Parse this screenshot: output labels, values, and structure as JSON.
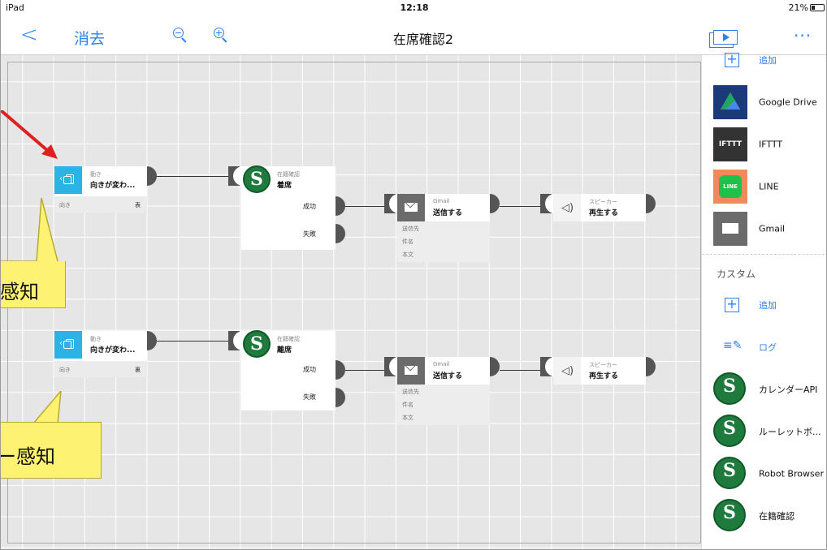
{
  "status_bar": {
    "device": "iPad",
    "time": "12:18",
    "right_info": "21%"
  },
  "nav": {
    "back_glyph": "<",
    "erase": "消去",
    "title": "在席確認2"
  },
  "flow": {
    "row1": {
      "motion": {
        "type": "動き",
        "name": "向きが変わ...",
        "param_key": "向き",
        "param_value": "表"
      },
      "presence": {
        "type": "在籍確認",
        "name": "着席",
        "out1": "成功",
        "out2": "失敗"
      },
      "gmail": {
        "type": "Gmail",
        "name": "送信する",
        "params": [
          "送信先",
          "件名",
          "本文"
        ]
      },
      "speaker": {
        "type": "スピーカー",
        "name": "再生する"
      }
    },
    "row2": {
      "motion": {
        "type": "動き",
        "name": "向きが変わ...",
        "param_key": "向き",
        "param_value": "裏"
      },
      "presence": {
        "type": "在籍確認",
        "name": "離席",
        "out1": "成功",
        "out2": "失敗"
      },
      "gmail": {
        "type": "Gmail",
        "name": "送信する",
        "params": [
          "送信先",
          "件名",
          "本文"
        ]
      },
      "speaker": {
        "type": "スピーカー",
        "name": "再生する"
      }
    }
  },
  "callouts": {
    "top": "感知",
    "bottom": "ー感知"
  },
  "sidebar": {
    "top_add": "追加",
    "items": [
      "Google Drive",
      "IFTTT",
      "LINE",
      "Gmail"
    ],
    "ifttt_logo": "IFTTT",
    "line_logo": "LINE",
    "custom_section": "カスタム",
    "custom_add": "追加",
    "log": "ログ",
    "custom_items": [
      "カレンダーAPI",
      "ルーレットボ...",
      "Robot Browser",
      "在籍確認"
    ]
  },
  "colors": {
    "accent": "#2f80ed",
    "motion": "#2bb3e6",
    "callout": "#fdf271",
    "arrow": "#e02020"
  }
}
